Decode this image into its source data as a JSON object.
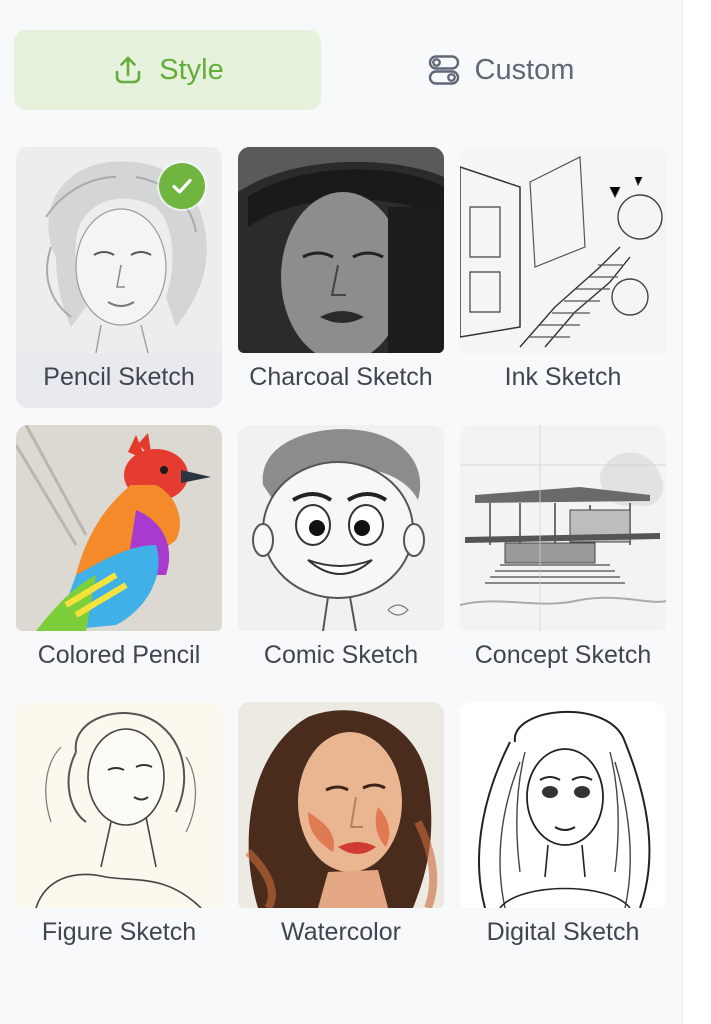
{
  "tabs": {
    "style_label": "Style",
    "custom_label": "Custom"
  },
  "styles": [
    {
      "label": "Pencil Sketch",
      "selected": true
    },
    {
      "label": "Charcoal Sketch"
    },
    {
      "label": "Ink Sketch"
    },
    {
      "label": "Colored Pencil"
    },
    {
      "label": "Comic Sketch"
    },
    {
      "label": "Concept Sketch"
    },
    {
      "label": "Figure Sketch"
    },
    {
      "label": "Watercolor"
    },
    {
      "label": "Digital Sketch"
    }
  ],
  "colors": {
    "accent": "#6fb53f",
    "accent_bg": "#e6f2dc",
    "text": "#3f4651",
    "muted": "#5f6876"
  }
}
